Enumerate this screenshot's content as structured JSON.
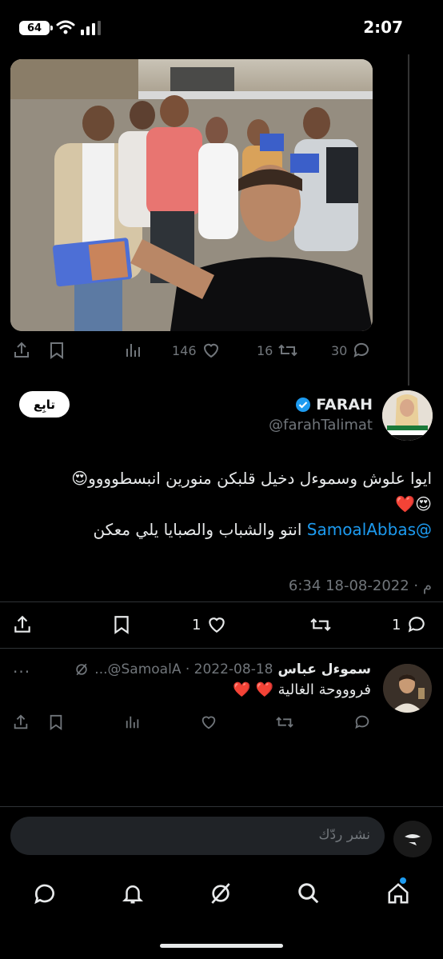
{
  "status": {
    "time": "2:07",
    "battery": "64"
  },
  "quoted_tweet": {
    "stats": {
      "likes": "146",
      "retweets": "16",
      "replies": "30"
    }
  },
  "tweet": {
    "follow_label": "تابِع",
    "author_name": "FARAH",
    "author_handle": "@farahTalimat",
    "line1": "ايوا علوش وسموءل دخيل قلبكن منورين انبسطوووو😍",
    "line2": "😍❤️",
    "line3_mention": "@SamoalAbbas",
    "line3_text": " انتو والشباب والصبايا يلي معكن",
    "timestamp": "6:34 م · 2022-08-18",
    "stats": {
      "likes": "1",
      "replies": "1"
    }
  },
  "reply": {
    "name": "سموءل عباس",
    "handle_date": "...@SamoalA · 2022-08-18",
    "text": "فروووحة الغالية ❤️ ❤️"
  },
  "compose": {
    "placeholder": "نشر ردّك"
  },
  "colors": {
    "accent": "#1d9bf0",
    "background": "#000000",
    "muted": "#71767b"
  }
}
